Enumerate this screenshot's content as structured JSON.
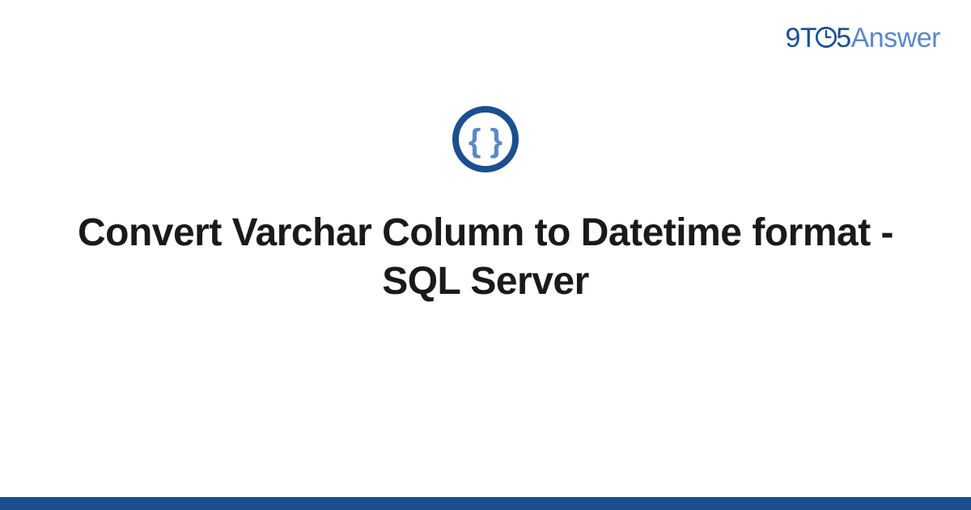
{
  "brand": {
    "prefix": "9T",
    "middle": "5",
    "suffix": "Answer"
  },
  "icon": {
    "name": "code-braces"
  },
  "title": "Convert Varchar Column to Datetime format - SQL Server",
  "colors": {
    "primary_dark": "#1b4f8f",
    "primary_light": "#5c88c5",
    "text": "#1a1a1a"
  }
}
